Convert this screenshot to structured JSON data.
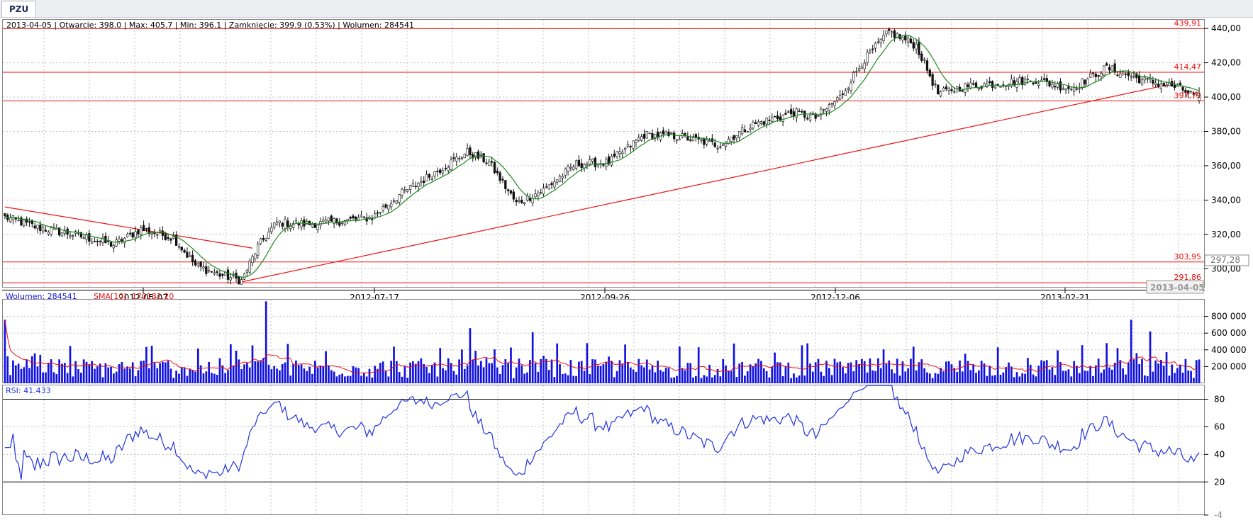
{
  "tab": {
    "label": "PZU"
  },
  "colors": {
    "candle_up": "#ffffff",
    "candle_down": "#111111",
    "sma_price": "#1f8a1f",
    "level_lines": "#ee1111",
    "volume_bars": "#1111dd",
    "volume_sma": "#ee1111",
    "rsi_line": "#2233dd",
    "grid": "#c0c0c0"
  },
  "chart_data": [
    {
      "type": "candlestick",
      "info_text": "2013-04-05 | Otwarcie: 398.0 | Max: 405.7 | Min: 396.1 | Zamknięcie: 399.9 (0.53%)  | Wolumen: 284541",
      "last_candle": {
        "date": "2013-04-05",
        "open": 398.0,
        "high": 405.7,
        "low": 396.1,
        "close": 399.9,
        "change_pct": 0.53,
        "volume": 284541
      },
      "x_tick_labels": [
        "2012-05-07",
        "2012-07-17",
        "2012-09-26",
        "2012-12-06",
        "2013-02-21"
      ],
      "current_date_label": "2013-04-05",
      "y_tick_labels": [
        "440,00",
        "420,00",
        "400,00",
        "380,00",
        "360,00",
        "340,00",
        "320,00",
        "300,00"
      ],
      "y_ticks": [
        440,
        420,
        400,
        380,
        360,
        340,
        320,
        300
      ],
      "ylim": [
        289,
        445
      ],
      "current_price_label": "297,28",
      "horizontal_levels": [
        {
          "label": "439,91",
          "value": 439.91
        },
        {
          "label": "414,47",
          "value": 414.47
        },
        {
          "label": "397,79",
          "value": 397.79
        },
        {
          "label": "303,95",
          "value": 303.95
        },
        {
          "label": "291,86",
          "value": 291.86
        }
      ],
      "trend_lines": [
        {
          "from": {
            "bar": 0,
            "value": 336
          },
          "to": {
            "bar": 91,
            "value": 312
          }
        },
        {
          "from": {
            "bar": 86,
            "value": 292
          },
          "to": {
            "bar": 430,
            "value": 408
          }
        }
      ],
      "bar_count": 440,
      "close_anchors": [
        [
          0,
          330
        ],
        [
          12,
          324
        ],
        [
          25,
          320
        ],
        [
          40,
          314
        ],
        [
          50,
          323
        ],
        [
          62,
          318
        ],
        [
          70,
          302
        ],
        [
          78,
          297
        ],
        [
          87,
          293
        ],
        [
          93,
          313
        ],
        [
          100,
          327
        ],
        [
          112,
          326
        ],
        [
          125,
          328
        ],
        [
          135,
          330
        ],
        [
          145,
          343
        ],
        [
          160,
          358
        ],
        [
          170,
          368
        ],
        [
          178,
          362
        ],
        [
          188,
          338
        ],
        [
          198,
          346
        ],
        [
          210,
          361
        ],
        [
          222,
          362
        ],
        [
          235,
          378
        ],
        [
          248,
          377
        ],
        [
          262,
          372
        ],
        [
          275,
          384
        ],
        [
          290,
          391
        ],
        [
          298,
          388
        ],
        [
          307,
          400
        ],
        [
          315,
          420
        ],
        [
          325,
          438
        ],
        [
          335,
          430
        ],
        [
          343,
          402
        ],
        [
          352,
          406
        ],
        [
          365,
          408
        ],
        [
          378,
          410
        ],
        [
          392,
          405
        ],
        [
          405,
          417
        ],
        [
          418,
          410
        ],
        [
          430,
          406
        ],
        [
          439,
          399.9
        ]
      ],
      "sma_price_series_note": ""
    },
    {
      "type": "bar",
      "legend": {
        "volume_label": "Wolumen: 284541",
        "sma_label": "SMA[10]: 170182.20"
      },
      "y_tick_labels": [
        "800 000",
        "600 000",
        "400 000",
        "200 000"
      ],
      "y_ticks": [
        800000,
        600000,
        400000,
        200000
      ],
      "ylim": [
        0,
        1000000
      ],
      "spikes": [
        [
          0,
          760000
        ],
        [
          96,
          980000
        ],
        [
          171,
          660000
        ],
        [
          194,
          610000
        ],
        [
          365,
          430000
        ],
        [
          405,
          480000
        ],
        [
          414,
          760000
        ],
        [
          421,
          620000
        ],
        [
          439,
          284541
        ]
      ],
      "sma_period": 10
    },
    {
      "type": "line",
      "legend": {
        "rsi_label": "RSI: 41.433"
      },
      "y_tick_labels": [
        "80",
        "60",
        "40",
        "20",
        "-4"
      ],
      "y_ticks": [
        80,
        60,
        40,
        20
      ],
      "ylim": [
        -4,
        90
      ],
      "levels": [
        80,
        20
      ],
      "current_value": 41.433
    }
  ]
}
